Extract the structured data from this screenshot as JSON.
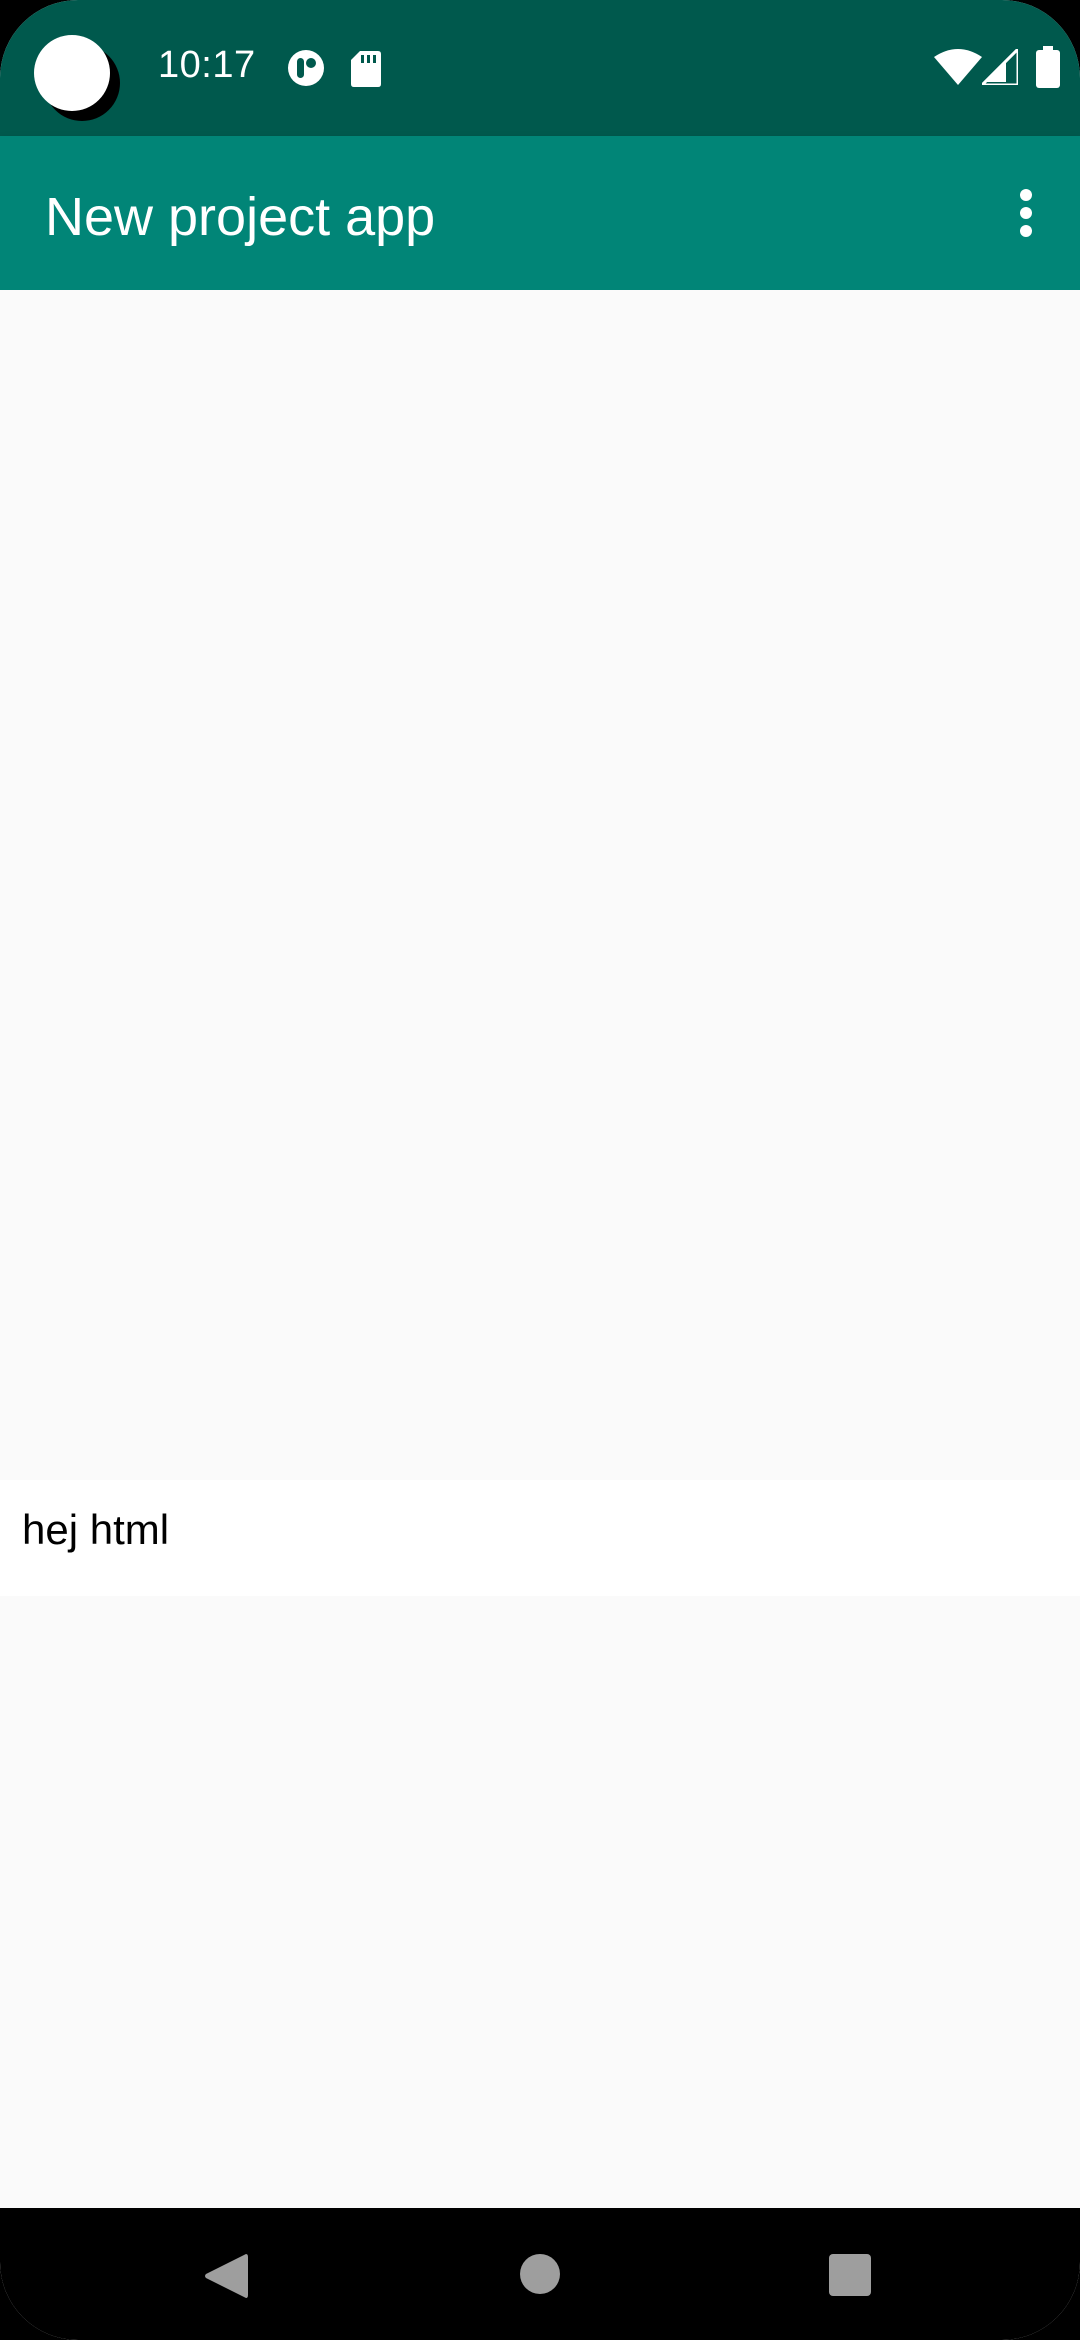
{
  "status_bar": {
    "time": "10:17",
    "left_icons": [
      "camera-cutout",
      "app-notification-icon",
      "sd-card-icon"
    ],
    "right_icons": [
      "wifi-icon",
      "cellular-signal-icon",
      "battery-icon"
    ],
    "background_color": "#00594d"
  },
  "app_bar": {
    "title": "New project app",
    "overflow_icon": "more-vert-icon",
    "background_color": "#018577"
  },
  "content": {
    "text": "hej html",
    "background_color": "#fafafa"
  },
  "nav_bar": {
    "buttons": [
      "back-icon",
      "home-icon",
      "recents-icon"
    ]
  }
}
